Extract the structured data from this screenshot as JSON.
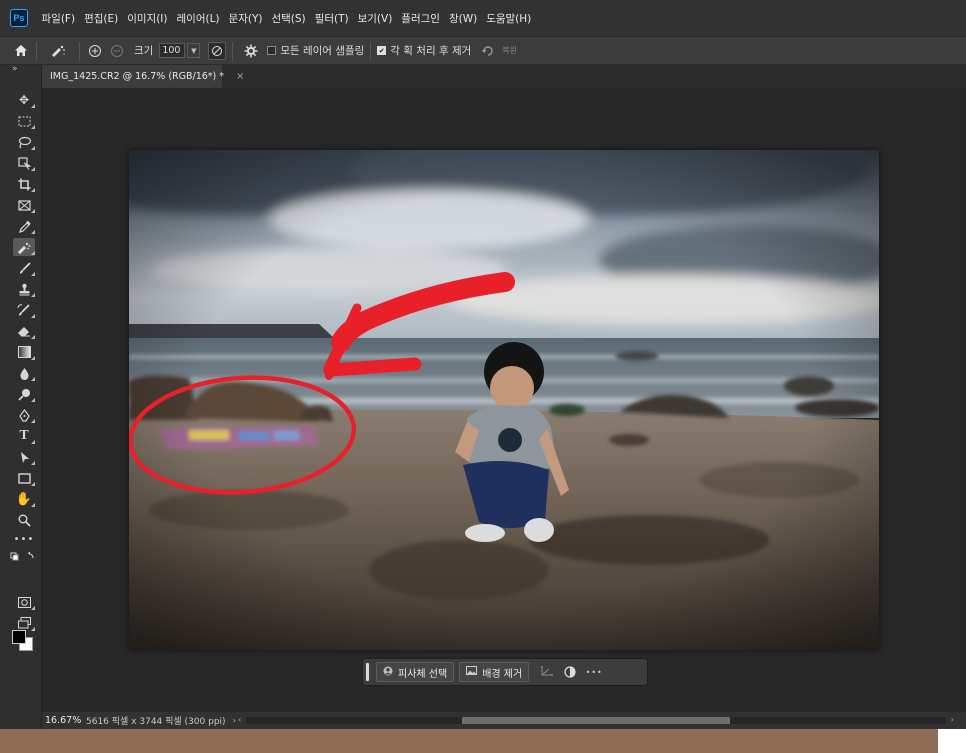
{
  "app": {
    "logo_text": "Ps"
  },
  "menu": [
    "파일(F)",
    "편집(E)",
    "이미지(I)",
    "레이어(L)",
    "문자(Y)",
    "선택(S)",
    "필터(T)",
    "보기(V)",
    "플러그인",
    "창(W)",
    "도움말(H)"
  ],
  "options": {
    "size_label": "크기",
    "size_value": "100",
    "sample_all_layers_label": "모든 레이어 샘플링",
    "sample_all_layers_checked": false,
    "stroke_process_label": "각 획 처리 후 제거",
    "stroke_process_checked": true,
    "restore_label": "복원"
  },
  "document_tab": {
    "title": "IMG_1425.CR2 @ 16.7% (RGB/16*) *",
    "close": "×"
  },
  "taskbar": {
    "select_subject": "피사체 선택",
    "remove_background": "배경 제거",
    "more": "•••"
  },
  "status": {
    "zoom": "16.67%",
    "doc_info": "5616 픽셀 x 3744 픽셀 (300 ppi)",
    "arrow": "›"
  },
  "colors": {
    "foreground": "#000000",
    "background": "#ffffff",
    "annotation_red": "#e8202a"
  },
  "tools": [
    "move-icon",
    "marquee-icon",
    "lasso-icon",
    "object-selection-icon",
    "crop-icon",
    "frame-icon",
    "eyedropper-icon",
    "spot-healing-icon",
    "brush-icon",
    "stamp-icon",
    "history-brush-icon",
    "eraser-icon",
    "gradient-icon",
    "blur-icon",
    "dodge-icon",
    "pen-icon",
    "type-icon",
    "path-select-icon",
    "rectangle-icon",
    "hand-icon",
    "zoom-icon",
    "more-tools-icon"
  ]
}
